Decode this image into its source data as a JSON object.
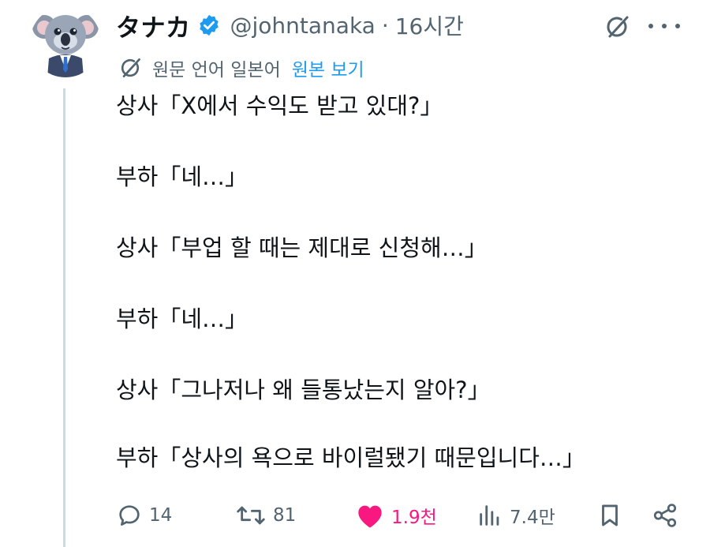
{
  "author": {
    "display_name": "タナカ",
    "handle": "@johntanaka",
    "separator": "·",
    "time": "16시간"
  },
  "translation": {
    "note": "원문 언어 일본어",
    "show_original": "원본 보기"
  },
  "tweet_lines": [
    "상사「X에서 수익도 받고 있대?」",
    "부하「네…」",
    "상사「부업 할 때는 제대로 신청해…」",
    "부하「네…」",
    "상사「그나저나 왜 들통났는지 알아?」",
    "부하「상사의 욕으로 바이럴됐기 때문입니다…」"
  ],
  "actions": {
    "replies": "14",
    "reposts": "81",
    "likes": "1.9천",
    "views": "7.4만"
  },
  "colors": {
    "text": "#0f1419",
    "secondary": "#536471",
    "link": "#1d9bf0",
    "like": "#f91880",
    "verified": "#1d9bf0",
    "thread_line": "#cfd9de"
  },
  "icons": [
    "avatar-koala",
    "verified-badge-icon",
    "grok-icon",
    "more-icon",
    "translate-icon",
    "reply-icon",
    "repost-icon",
    "heart-icon",
    "views-icon",
    "bookmark-icon",
    "share-icon"
  ]
}
